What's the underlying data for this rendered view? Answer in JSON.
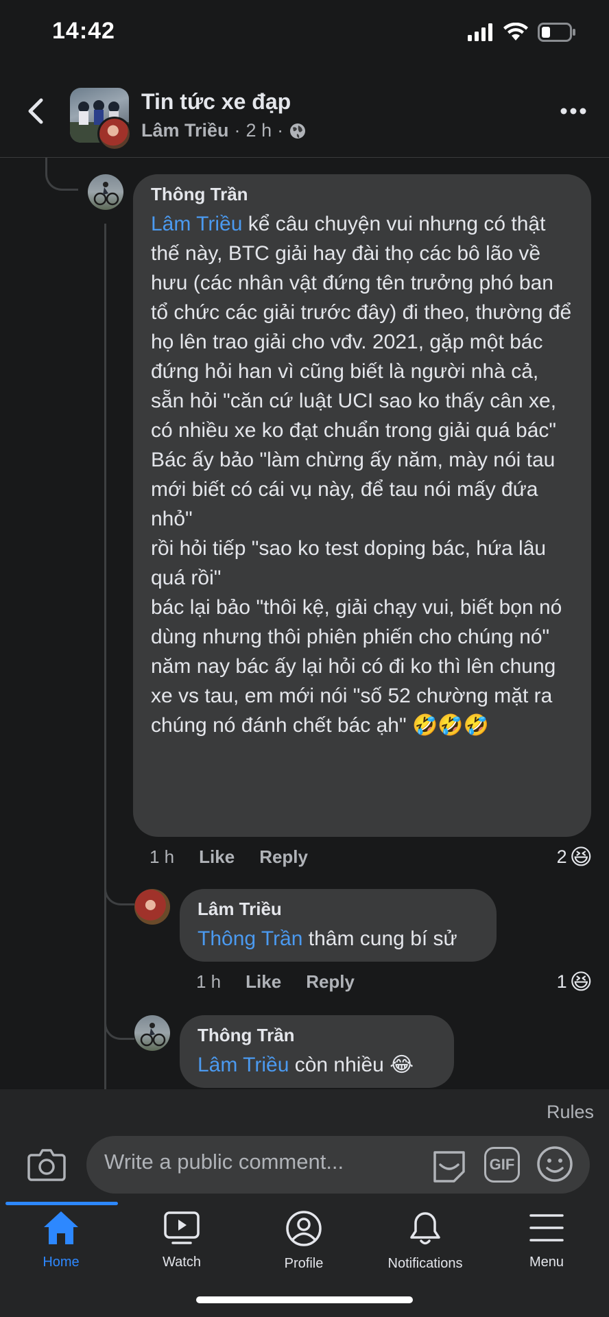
{
  "status": {
    "time": "14:42"
  },
  "header": {
    "title": "Tin tức xe đạp",
    "author": "Lâm Triều",
    "time": "2 h",
    "sep": "·"
  },
  "comments": [
    {
      "author": "Thông Trần",
      "mention": "Lâm Triều",
      "text": " kể câu chuyện vui nhưng có thật thế này, BTC giải hay đài thọ các bô lão về hưu (các nhân vật đứng tên trưởng phó ban tổ chức các giải trước đây) đi theo, thường để họ lên trao giải cho vđv. 2021, gặp một bác đứng hỏi han vì cũng biết là người nhà cả, sẵn hỏi \"căn cứ luật UCI sao ko thấy cân xe, có nhiều xe ko đạt chuẩn trong giải quá bác\"\nBác ấy bảo \"làm chừng ấy năm, mày nói tau mới biết có cái vụ này, để tau nói mấy đứa nhỏ\"\nrồi hỏi tiếp \"sao ko test doping bác, hứa lâu quá rồi\"\nbác lại bảo \"thôi kệ, giải chạy vui, biết bọn nó dùng nhưng thôi phiên phiến cho chúng nó\"\nnăm nay bác ấy lại hỏi có đi ko thì lên chung xe vs tau, em mới nói \"số 52 chường mặt ra chúng nó đánh chết bác ạh\" 🤣🤣🤣",
      "time": "1 h",
      "like": "Like",
      "reply": "Reply",
      "reaction_count": "2",
      "reaction": "😆"
    },
    {
      "author": "Lâm Triều",
      "mention": "Thông Trần",
      "text": " thâm cung bí sử",
      "time": "1 h",
      "like": "Like",
      "reply": "Reply",
      "reaction_count": "1",
      "reaction": "😆"
    },
    {
      "author": "Thông Trần",
      "mention": "Lâm Triều",
      "text": " còn nhiều 😂"
    }
  ],
  "composer": {
    "rules": "Rules",
    "placeholder": "Write a public comment...",
    "gif": "GIF"
  },
  "tabs": [
    {
      "label": "Home",
      "active": true
    },
    {
      "label": "Watch"
    },
    {
      "label": "Profile"
    },
    {
      "label": "Notifications"
    },
    {
      "label": "Menu"
    }
  ],
  "colors": {
    "accent": "#2d88ff",
    "mention": "#4b9af0",
    "bubble": "#3a3b3c",
    "bg": "#18191a"
  }
}
